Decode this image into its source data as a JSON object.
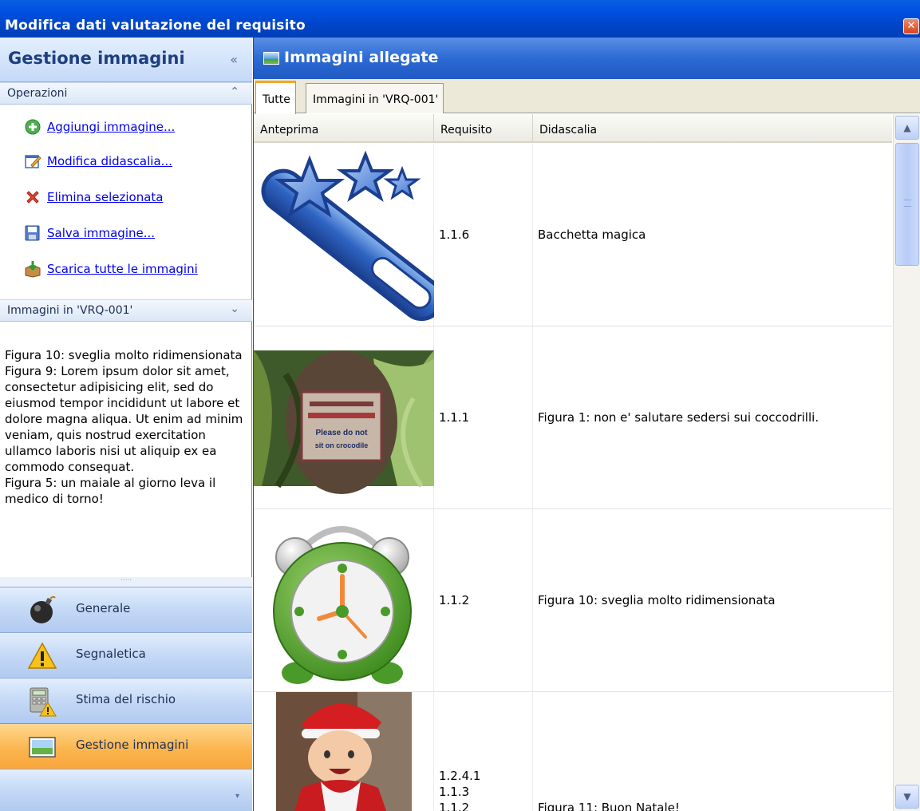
{
  "window": {
    "title": "Modifica dati valutazione del requisito",
    "close_glyph": "✕"
  },
  "left_panel": {
    "title": "Gestione immagini",
    "collapse_glyph": "«",
    "operations": {
      "header": "Operazioni",
      "chevron": "⌃",
      "items": [
        {
          "label": "Aggiungi immagine...",
          "icon": "add-icon"
        },
        {
          "label": "Modifica didascalia...",
          "icon": "edit-icon"
        },
        {
          "label": "Elimina selezionata",
          "icon": "delete-icon"
        },
        {
          "label": "Salva immagine...",
          "icon": "save-icon"
        },
        {
          "label": "Scarica tutte le immagini",
          "icon": "download-icon"
        }
      ]
    },
    "images_section": {
      "header": "Immagini in 'VRQ-001'",
      "chevron": "⌄",
      "description": "Figura 10: sveglia molto ridimensionata\nFigura 9: Lorem ipsum dolor sit amet, consectetur adipisicing elit, sed do eiusmod tempor incididunt ut labore et dolore magna aliqua. Ut enim ad minim veniam, quis nostrud exercitation ullamco laboris nisi ut aliquip ex ea commodo consequat.\nFigura 5: un maiale al giorno leva il medico di torno!"
    },
    "grip": "·····",
    "nav": [
      {
        "label": "Generale",
        "icon": "bomb-icon",
        "active": false
      },
      {
        "label": "Segnaletica",
        "icon": "warning-icon",
        "active": false
      },
      {
        "label": "Stima del rischio",
        "icon": "calculator-icon",
        "active": false
      },
      {
        "label": "Gestione immagini",
        "icon": "image-icon",
        "active": true
      }
    ],
    "overflow_arrow": "▾"
  },
  "right_panel": {
    "title": "Immagini allegate",
    "tabs": [
      {
        "label": "Tutte",
        "selected": true
      },
      {
        "label": "Immagini in 'VRQ-001'",
        "selected": false
      }
    ],
    "columns": [
      "Anteprima",
      "Requisito",
      "Didascalia"
    ],
    "rows": [
      {
        "thumb": "magic-wand-image",
        "requisito": "1.1.6",
        "didascalia": "Bacchetta magica"
      },
      {
        "thumb": "crocodile-sign-image",
        "requisito": "1.1.1",
        "didascalia": "Figura 1: non e' salutare sedersi sui coccodrilli.",
        "sign_text": [
          "Please do not",
          "sit on crocodile"
        ]
      },
      {
        "thumb": "alarm-clock-image",
        "requisito": "1.1.2",
        "didascalia": "Figura 10: sveglia molto ridimensionata"
      },
      {
        "thumb": "baby-santa-image",
        "requisito": "1.2.4.1\n1.1.3\n1.1.2",
        "didascalia": "Figura 11: Buon Natale!"
      }
    ],
    "scroll_up": "▲",
    "scroll_down": "▼"
  }
}
